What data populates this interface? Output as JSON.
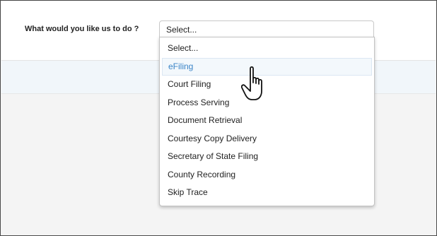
{
  "form": {
    "question_label": "What would you like us to do ?",
    "select_value": "Select...",
    "options": [
      "Select...",
      "eFiling",
      "Court Filing",
      "Process Serving",
      "Document Retrieval",
      "Courtesy Copy Delivery",
      "Secretary of State Filing",
      "County Recording",
      "Skip Trace"
    ],
    "highlighted_option": "eFiling",
    "highlight_color": "#3a84c7"
  },
  "cursor": {
    "icon": "hand-pointer-icon"
  }
}
